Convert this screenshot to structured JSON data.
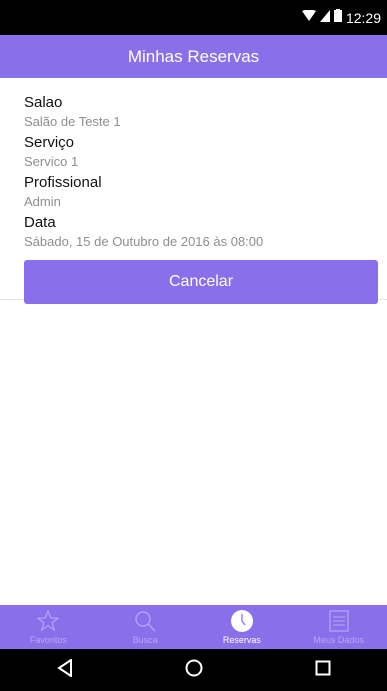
{
  "status_bar": {
    "time": "12:29"
  },
  "header": {
    "title": "Minhas Reservas"
  },
  "reservation": {
    "salao_label": "Salao",
    "salao_value": "Salão de Teste 1",
    "servico_label": "Serviço",
    "servico_value": "Servico 1",
    "profissional_label": "Profissional",
    "profissional_value": "Admin",
    "data_label": "Data",
    "data_value": "Sábado, 15 de Outubro de 2016 às 08:00",
    "cancel_label": "Cancelar"
  },
  "tabs": [
    {
      "label": "Favoritos",
      "icon": "star-icon",
      "active": false
    },
    {
      "label": "Busca",
      "icon": "search-icon",
      "active": false
    },
    {
      "label": "Reservas",
      "icon": "clock-icon",
      "active": true
    },
    {
      "label": "Meus Dados",
      "icon": "list-icon",
      "active": false
    }
  ],
  "colors": {
    "accent": "#8a6fea",
    "tab_inactive": "#b9a7f3",
    "label": "#111111",
    "value": "#8e8e8e"
  }
}
